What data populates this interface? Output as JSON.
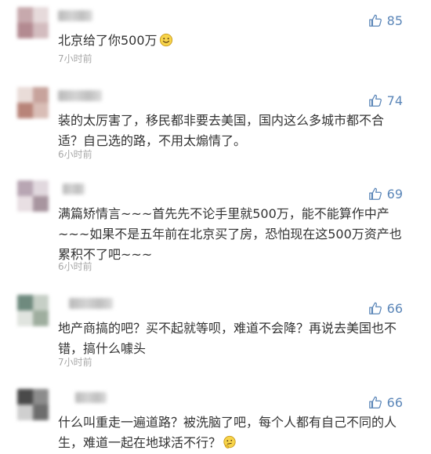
{
  "comments": [
    {
      "text": "北京给了你500万",
      "time": "7小时前",
      "likes": "85",
      "emoji": "smile-emoji"
    },
    {
      "text": "装的太厉害了，移民都非要去美国，国内这么多城市都不合适？自己选的路，不用太煽情了。",
      "time": "6小时前",
      "likes": "74"
    },
    {
      "text": "满篇矫情言~~~首先先不论手里就500万，能不能算作中产~~~如果不是五年前在北京买了房，恐怕现在这500万资产也累积不了吧~~~",
      "time": "6小时前",
      "likes": "69"
    },
    {
      "text": "地产商搞的吧？买不起就等呗，难道不会降？再说去美国也不错，搞什么噱头",
      "time": "7小时前",
      "likes": "66"
    },
    {
      "text": "什么叫重走一遍道路？被洗脑了吧，每个人都有自己不同的人生，难道一起在地球活不行？",
      "time": "",
      "likes": "66",
      "emoji": "thinking-emoji"
    }
  ],
  "colors": {
    "text": "#333333",
    "time": "#a8a8a8",
    "like": "#5b86b8"
  }
}
